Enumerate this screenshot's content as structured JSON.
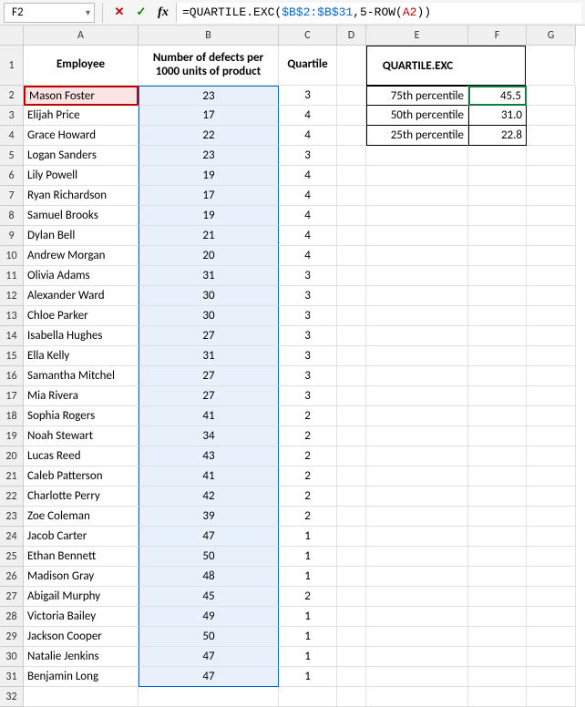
{
  "nameBox": "F2",
  "formula": {
    "prefix": "=QUARTILE.EXC(",
    "range": "$B$2:$B$31",
    "mid": ",5-ROW(",
    "rel": "A2",
    "suffix": "))"
  },
  "columns": [
    "A",
    "B",
    "C",
    "D",
    "E",
    "F",
    "G"
  ],
  "headers": {
    "A": "Employee",
    "B": "Number of defects per 1000 units of product",
    "C": "Quartile",
    "EF": "QUARTILE.EXC"
  },
  "rows": [
    {
      "n": 2,
      "emp": "Mason Foster",
      "def": "23",
      "q": "3",
      "eLabel": "75th percentile",
      "eVal": "45.5"
    },
    {
      "n": 3,
      "emp": "Elijah Price",
      "def": "17",
      "q": "4",
      "eLabel": "50th percentile",
      "eVal": "31.0"
    },
    {
      "n": 4,
      "emp": "Grace Howard",
      "def": "22",
      "q": "4",
      "eLabel": "25th percentile",
      "eVal": "22.8"
    },
    {
      "n": 5,
      "emp": "Logan Sanders",
      "def": "23",
      "q": "3"
    },
    {
      "n": 6,
      "emp": "Lily Powell",
      "def": "19",
      "q": "4"
    },
    {
      "n": 7,
      "emp": "Ryan Richardson",
      "def": "17",
      "q": "4"
    },
    {
      "n": 8,
      "emp": "Samuel Brooks",
      "def": "19",
      "q": "4"
    },
    {
      "n": 9,
      "emp": "Dylan Bell",
      "def": "21",
      "q": "4"
    },
    {
      "n": 10,
      "emp": "Andrew Morgan",
      "def": "20",
      "q": "4"
    },
    {
      "n": 11,
      "emp": "Olivia Adams",
      "def": "31",
      "q": "3"
    },
    {
      "n": 12,
      "emp": "Alexander Ward",
      "def": "30",
      "q": "3"
    },
    {
      "n": 13,
      "emp": "Chloe Parker",
      "def": "30",
      "q": "3"
    },
    {
      "n": 14,
      "emp": "Isabella Hughes",
      "def": "27",
      "q": "3"
    },
    {
      "n": 15,
      "emp": "Ella Kelly",
      "def": "31",
      "q": "3"
    },
    {
      "n": 16,
      "emp": "Samantha Mitchel",
      "def": "27",
      "q": "3"
    },
    {
      "n": 17,
      "emp": "Mia Rivera",
      "def": "27",
      "q": "3"
    },
    {
      "n": 18,
      "emp": "Sophia Rogers",
      "def": "41",
      "q": "2"
    },
    {
      "n": 19,
      "emp": "Noah Stewart",
      "def": "34",
      "q": "2"
    },
    {
      "n": 20,
      "emp": "Lucas Reed",
      "def": "43",
      "q": "2"
    },
    {
      "n": 21,
      "emp": "Caleb Patterson",
      "def": "41",
      "q": "2"
    },
    {
      "n": 22,
      "emp": "Charlotte Perry",
      "def": "42",
      "q": "2"
    },
    {
      "n": 23,
      "emp": "Zoe Coleman",
      "def": "39",
      "q": "2"
    },
    {
      "n": 24,
      "emp": "Jacob Carter",
      "def": "47",
      "q": "1"
    },
    {
      "n": 25,
      "emp": "Ethan Bennett",
      "def": "50",
      "q": "1"
    },
    {
      "n": 26,
      "emp": "Madison Gray",
      "def": "48",
      "q": "1"
    },
    {
      "n": 27,
      "emp": "Abigail Murphy",
      "def": "45",
      "q": "2"
    },
    {
      "n": 28,
      "emp": "Victoria Bailey",
      "def": "49",
      "q": "1"
    },
    {
      "n": 29,
      "emp": "Jackson Cooper",
      "def": "50",
      "q": "1"
    },
    {
      "n": 30,
      "emp": "Natalie Jenkins",
      "def": "47",
      "q": "1"
    },
    {
      "n": 31,
      "emp": "Benjamin Long",
      "def": "47",
      "q": "1"
    }
  ],
  "lastRow": 32
}
